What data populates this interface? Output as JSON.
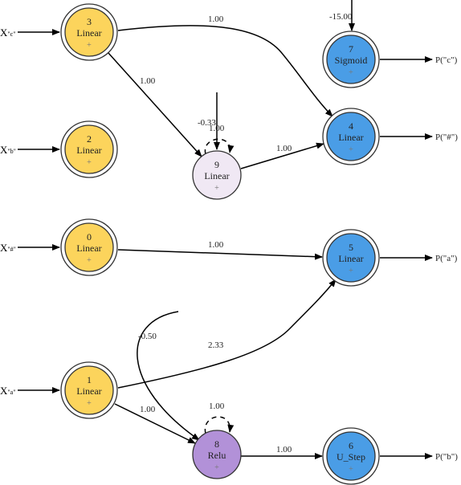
{
  "colors": {
    "input": "#fcd45c",
    "output": "#4a9de6",
    "hidden_linear": "#f0e8f4",
    "relu": "#b291d8"
  },
  "nodes": {
    "n0": {
      "id": "0",
      "type": "Linear",
      "sign": "+"
    },
    "n1": {
      "id": "1",
      "type": "Linear",
      "sign": "+"
    },
    "n2": {
      "id": "2",
      "type": "Linear",
      "sign": "+"
    },
    "n3": {
      "id": "3",
      "type": "Linear",
      "sign": "+"
    },
    "n4": {
      "id": "4",
      "type": "Linear",
      "sign": "+"
    },
    "n5": {
      "id": "5",
      "type": "Linear",
      "sign": "+"
    },
    "n6": {
      "id": "6",
      "type": "U_Step",
      "sign": "+"
    },
    "n7": {
      "id": "7",
      "type": "Sigmoid",
      "sign": "+"
    },
    "n8": {
      "id": "8",
      "type": "Relu",
      "sign": "+"
    },
    "n9": {
      "id": "9",
      "type": "Linear",
      "sign": "+"
    }
  },
  "inputs": {
    "c": {
      "x": "X",
      "sub": "\"c\""
    },
    "b": {
      "x": "X",
      "sub": "\"b\""
    },
    "hash": {
      "x": "X",
      "sub": "\"#\""
    },
    "a": {
      "x": "X",
      "sub": "\"a\""
    }
  },
  "outputs": {
    "c": "P(\"c\")",
    "hash": "P(\"#\")",
    "a": "P(\"a\")",
    "b": "P(\"b\")"
  },
  "edges": {
    "e3_4": "1.00",
    "e3_9": "1.00",
    "bias9": "-0.33",
    "self9": "1.00",
    "e9_4": "1.00",
    "e0_5": "1.00",
    "e1_5": "2.33",
    "bias8": "-0.50",
    "e1_8": "1.00",
    "self8": "1.00",
    "e8_6": "1.00",
    "bias7": "-15.00"
  }
}
